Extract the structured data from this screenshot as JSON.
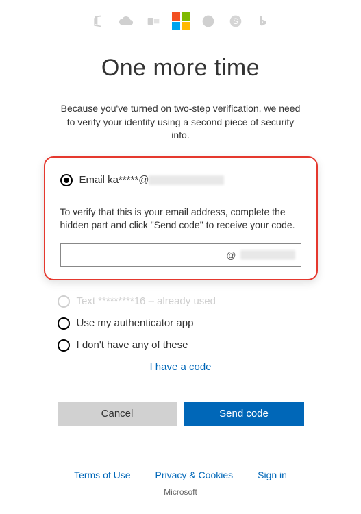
{
  "title": "One more time",
  "subtitle": "Because you've turned on two-step verification, we need to verify your identity using a second piece of security info.",
  "options": {
    "email": {
      "label_prefix": "Email ka*****@",
      "selected": true,
      "verify_text": "To verify that this is your email address, complete the hidden part and click \"Send code\" to receive your code.",
      "at_symbol": "@"
    },
    "text_disabled": "Text *********16 – already used",
    "authenticator": "Use my authenticator app",
    "none": "I don't have any of these"
  },
  "links": {
    "have_code": "I have a code"
  },
  "buttons": {
    "cancel": "Cancel",
    "send": "Send code"
  },
  "footer": {
    "terms": "Terms of Use",
    "privacy": "Privacy & Cookies",
    "signin": "Sign in",
    "brand": "Microsoft"
  }
}
